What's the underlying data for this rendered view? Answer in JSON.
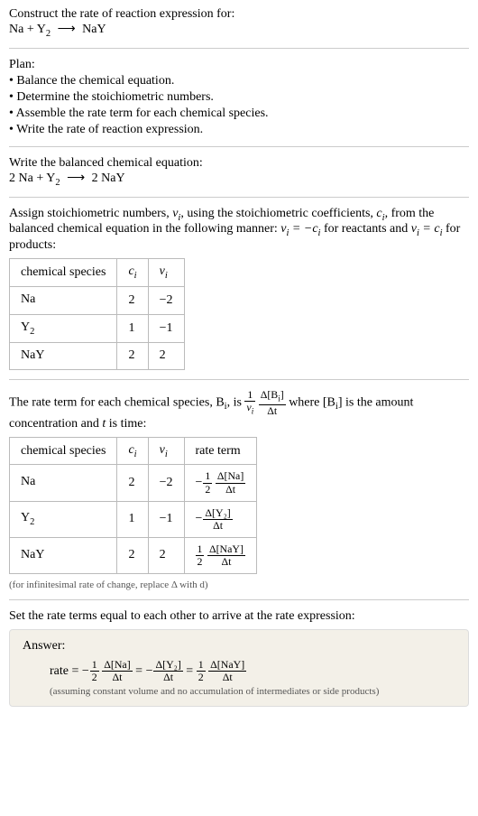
{
  "header": {
    "prompt": "Construct the rate of reaction expression for:",
    "equation_lhs1": "Na",
    "equation_plus": " + ",
    "equation_lhs2": "Y",
    "equation_lhs2_sub": "2",
    "equation_arrow": "⟶",
    "equation_rhs": "NaY"
  },
  "plan": {
    "title": "Plan:",
    "items": [
      "Balance the chemical equation.",
      "Determine the stoichiometric numbers.",
      "Assemble the rate term for each chemical species.",
      "Write the rate of reaction expression."
    ]
  },
  "balanced": {
    "title": "Write the balanced chemical equation:",
    "coef1": "2 ",
    "sp1": "Na",
    "plus": " + ",
    "sp2": "Y",
    "sp2_sub": "2",
    "arrow": "⟶",
    "coef2": "2 ",
    "sp3": "NaY"
  },
  "assign": {
    "text1": "Assign stoichiometric numbers, ",
    "nu": "ν",
    "sub_i": "i",
    "text2": ", using the stoichiometric coefficients, ",
    "c": "c",
    "text3": ", from the balanced chemical equation in the following manner: ",
    "eq1_lhs": "ν",
    "eq1_eq": " = −",
    "eq1_rhs": "c",
    "text4": " for reactants and ",
    "eq2_lhs": "ν",
    "eq2_eq": " = ",
    "eq2_rhs": "c",
    "text5": " for products:"
  },
  "table1": {
    "h1": "chemical species",
    "h2": "c",
    "h2sub": "i",
    "h3": "ν",
    "h3sub": "i",
    "rows": [
      {
        "sp": "Na",
        "spsub": "",
        "c": "2",
        "nu": "−2"
      },
      {
        "sp": "Y",
        "spsub": "2",
        "c": "1",
        "nu": "−1"
      },
      {
        "sp": "NaY",
        "spsub": "",
        "c": "2",
        "nu": "2"
      }
    ]
  },
  "rateterm": {
    "text1": "The rate term for each chemical species, B",
    "sub_i": "i",
    "text2": ", is ",
    "frac1_num": "1",
    "frac1_den_nu": "ν",
    "frac2_num_delta": "Δ[B",
    "frac2_num_close": "]",
    "frac2_den": "Δt",
    "text3": " where [B",
    "text4": "] is the amount concentration and ",
    "t": "t",
    "text5": " is time:"
  },
  "table2": {
    "h1": "chemical species",
    "h2": "c",
    "h2sub": "i",
    "h3": "ν",
    "h3sub": "i",
    "h4": "rate term",
    "rows": [
      {
        "sp": "Na",
        "spsub": "",
        "c": "2",
        "nu": "−2",
        "sign": "−",
        "fnum": "1",
        "fden": "2",
        "dnum": "Δ[Na]",
        "dden": "Δt"
      },
      {
        "sp": "Y",
        "spsub": "2",
        "c": "1",
        "nu": "−1",
        "sign": "−",
        "fnum": "",
        "fden": "",
        "dnum": "Δ[Y₂]",
        "dden": "Δt"
      },
      {
        "sp": "NaY",
        "spsub": "",
        "c": "2",
        "nu": "2",
        "sign": "",
        "fnum": "1",
        "fden": "2",
        "dnum": "Δ[NaY]",
        "dden": "Δt"
      }
    ],
    "note": "(for infinitesimal rate of change, replace Δ with d)"
  },
  "setequal": "Set the rate terms equal to each other to arrive at the rate expression:",
  "answer": {
    "title": "Answer:",
    "rate": "rate = ",
    "t1_sign": "−",
    "t1_fnum": "1",
    "t1_fden": "2",
    "t1_dnum": "Δ[Na]",
    "t1_dden": "Δt",
    "eq": " = ",
    "t2_sign": "−",
    "t2_dnum": "Δ[Y₂]",
    "t2_dden": "Δt",
    "t3_fnum": "1",
    "t3_fden": "2",
    "t3_dnum": "Δ[NaY]",
    "t3_dden": "Δt",
    "note": "(assuming constant volume and no accumulation of intermediates or side products)"
  }
}
